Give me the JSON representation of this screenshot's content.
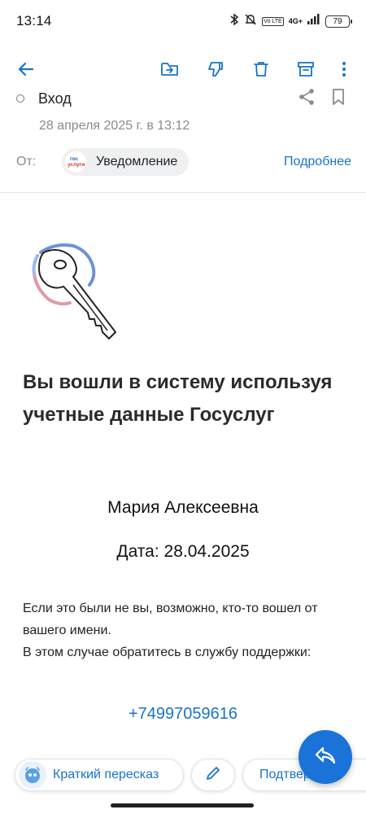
{
  "status_bar": {
    "time": "13:14",
    "battery": "79",
    "network": "4G+",
    "volte": "Vo LTE",
    "icons": [
      "bluetooth-icon",
      "mute-icon",
      "volte-icon",
      "signal-icon",
      "battery-icon"
    ]
  },
  "toolbar": {
    "icons": [
      "back-arrow-icon",
      "move-to-folder-icon",
      "spam-icon",
      "delete-icon",
      "archive-icon",
      "more-vertical-icon"
    ],
    "accent_color": "#1a73c8"
  },
  "mail": {
    "folder": "Вход",
    "date": "28 апреля 2025 г. в 13:12",
    "from_label": "От:",
    "sender_logo_line1": "гос",
    "sender_logo_line2": "услуги",
    "sender_name": "Уведомление",
    "details_link": "Подробнее"
  },
  "body": {
    "headline": "Вы вошли в систему используя учетные данные Госуслуг",
    "user_name": "Мария Алексеевна",
    "login_date": "Дата: 28.04.2025",
    "notice_line1": "Если это были не вы, возможно, кто-то вошел от вашего имени.",
    "notice_line2": "В этом случае обратитесь в службу поддержки:",
    "phone": "+74997059616"
  },
  "actions": {
    "summary_label": "Краткий пересказ",
    "confirm_label": "Подтверждаю",
    "fab_icon": "reply-icon"
  }
}
